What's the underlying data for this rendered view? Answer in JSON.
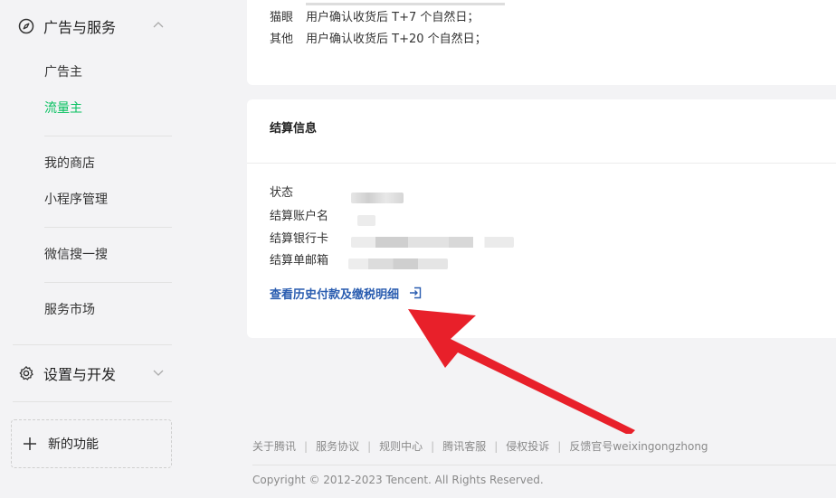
{
  "sidebar": {
    "group_ads": "广告与服务",
    "items": [
      {
        "label": "广告主"
      },
      {
        "label": "流量主"
      },
      {
        "label": "我的商店"
      },
      {
        "label": "小程序管理"
      },
      {
        "label": "微信搜一搜"
      },
      {
        "label": "服务市场"
      }
    ],
    "group_settings": "设置与开发",
    "new_feature": "新的功能"
  },
  "settlement_rules": [
    {
      "label": "猫眼",
      "text": "用户确认收货后 T+7 个自然日；"
    },
    {
      "label": "其他",
      "text": "用户确认收货后 T+20 个自然日；"
    }
  ],
  "settlement_info": {
    "title": "结算信息",
    "fields": [
      "状态",
      "结算账户名",
      "结算银行卡",
      "结算单邮箱"
    ],
    "link": "查看历史付款及缴税明细"
  },
  "footer": {
    "links": [
      "关于腾讯",
      "服务协议",
      "规则中心",
      "腾讯客服",
      "侵权投诉",
      "反馈官号weixingongzhong"
    ],
    "copyright": "Copyright © 2012-2023 Tencent. All Rights Reserved."
  },
  "colors": {
    "active": "#07c160",
    "link": "#2a5db0",
    "arrow": "#e8202a"
  }
}
